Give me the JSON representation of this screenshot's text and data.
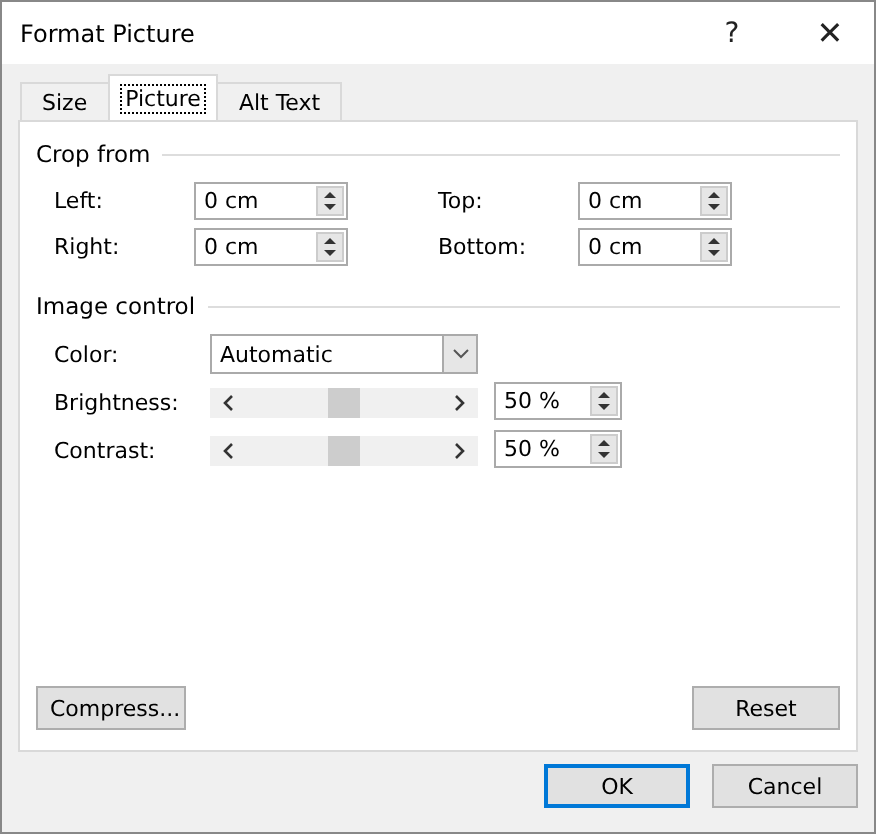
{
  "window": {
    "title": "Format Picture",
    "help": "?",
    "close": "✕"
  },
  "tabs": [
    {
      "label": "Size",
      "selected": false
    },
    {
      "label": "Picture",
      "selected": true
    },
    {
      "label": "Alt Text",
      "selected": false
    }
  ],
  "crop": {
    "title": "Crop from",
    "fields": [
      {
        "label": "Left:",
        "value": "0 cm"
      },
      {
        "label": "Top:",
        "value": "0 cm"
      },
      {
        "label": "Right:",
        "value": "0 cm"
      },
      {
        "label": "Bottom:",
        "value": "0 cm"
      }
    ]
  },
  "image_control": {
    "title": "Image control",
    "color": {
      "label": "Color:",
      "value": "Automatic"
    },
    "sliders": [
      {
        "label": "Brightness:",
        "level": 0.5,
        "value": "50 %"
      },
      {
        "label": "Contrast:",
        "level": 0.5,
        "value": "50 %"
      }
    ]
  },
  "panel_buttons": [
    "Compress...",
    "Reset"
  ],
  "buttons": [
    {
      "label": "OK",
      "default": true
    },
    {
      "label": "Cancel",
      "default": false
    }
  ]
}
